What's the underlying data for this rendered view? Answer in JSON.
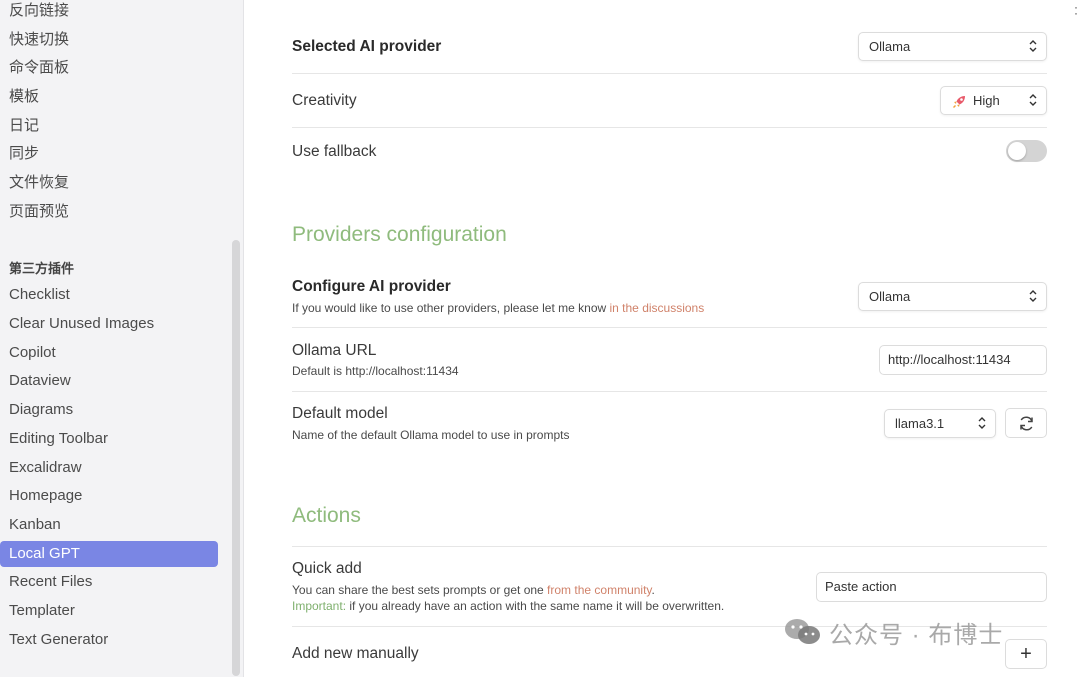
{
  "sidebar": {
    "core_items": [
      "反向链接",
      "快速切换",
      "命令面板",
      "模板",
      "日记",
      "同步",
      "文件恢复",
      "页面预览"
    ],
    "plugins_heading": "第三方插件",
    "plugin_items": [
      "Checklist",
      "Clear Unused Images",
      "Copilot",
      "Dataview",
      "Diagrams",
      "Editing Toolbar",
      "Excalidraw",
      "Homepage",
      "Kanban",
      "Local GPT",
      "Recent Files",
      "Templater",
      "Text Generator"
    ],
    "active_item": "Local GPT"
  },
  "settings": {
    "selected_provider": {
      "label": "Selected AI provider",
      "value": "Ollama"
    },
    "creativity": {
      "label": "Creativity",
      "value": "High",
      "icon": "rocket-icon"
    },
    "use_fallback": {
      "label": "Use fallback",
      "enabled": false
    },
    "providers_section": "Providers configuration",
    "configure_provider": {
      "label": "Configure AI provider",
      "desc": "If you would like to use other providers, please let me know ",
      "desc_link": "in the discussions",
      "value": "Ollama"
    },
    "ollama_url": {
      "label": "Ollama URL",
      "desc": "Default is http://localhost:11434",
      "value": "http://localhost:11434"
    },
    "default_model": {
      "label": "Default model",
      "desc": "Name of the default Ollama model to use in prompts",
      "value": "llama3.1",
      "refresh_icon": "refresh-icon"
    },
    "actions_section": "Actions",
    "quick_add": {
      "label": "Quick add",
      "desc_prefix": "You can share the best sets prompts or get one ",
      "desc_link": "from the community",
      "desc_suffix": ".",
      "important_label": "Important:",
      "important_text": " if you already have an action with the same name it will be overwritten.",
      "placeholder": "Paste action"
    },
    "add_manually": {
      "label": "Add new manually",
      "button": "+"
    }
  },
  "watermark": "公众号 · 布博士",
  "colors": {
    "accent": "#7a86e4",
    "section_title": "#8fbb7d",
    "link": "#d0826a"
  }
}
